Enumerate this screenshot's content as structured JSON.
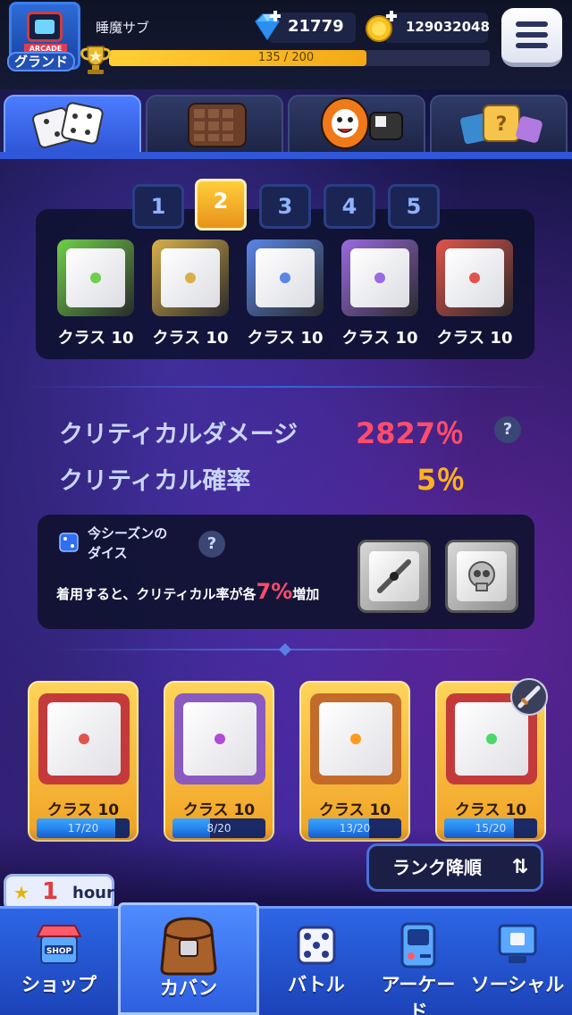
{
  "header": {
    "username": "睡魔サブ",
    "rank": "グランド",
    "avatar_text": "ARCADE",
    "xp_text": "135 / 200",
    "xp_fraction": 0.675,
    "gems": "21779",
    "coins": "129032048"
  },
  "deck_pages": [
    "1",
    "2",
    "3",
    "4",
    "5"
  ],
  "active_page": "2",
  "deck": [
    {
      "label": "クラス 10",
      "color": "#6fcf4a"
    },
    {
      "label": "クラス 10",
      "color": "#d8b04a"
    },
    {
      "label": "クラス 10",
      "color": "#5a86e8"
    },
    {
      "label": "クラス 10",
      "color": "#9a6ae0"
    },
    {
      "label": "クラス 10",
      "color": "#e0544a"
    }
  ],
  "stats": {
    "crit_damage_label": "クリティカルダメージ",
    "crit_damage_value": "2827％",
    "crit_rate_label": "クリティカル確率",
    "crit_rate_value": "5％",
    "help": "?"
  },
  "season": {
    "title_line1": "今シーズンの",
    "title_line2": "ダイス",
    "desc_before": "着用すると、クリティカル率が各",
    "desc_pct": "7%",
    "desc_after": "増加",
    "help": "?"
  },
  "inventory": [
    {
      "label": "クラス 10",
      "progress": "17/20",
      "fraction": 0.85,
      "color": "#e0544a",
      "frame": "#c43a3a"
    },
    {
      "label": "クラス 10",
      "progress": "8/20",
      "fraction": 0.4,
      "color": "#b04ad8",
      "frame": "#8a5ac0"
    },
    {
      "label": "クラス 10",
      "progress": "13/20",
      "fraction": 0.65,
      "color": "#ff9a1f",
      "frame": "#c46a2a"
    },
    {
      "label": "クラス 10",
      "progress": "15/20",
      "fraction": 0.75,
      "color": "#4ad86a",
      "frame": "#c43a3a"
    }
  ],
  "sort_button": "ランク降順",
  "timer": {
    "value": "1",
    "unit": "hour"
  },
  "nav": [
    {
      "label": "ショップ",
      "icon": "shop-icon",
      "sub": "SHOP"
    },
    {
      "label": "カバン",
      "icon": "bag-icon"
    },
    {
      "label": "バトル",
      "icon": "battle-dice-icon"
    },
    {
      "label": "アーケード",
      "icon": "arcade-icon"
    },
    {
      "label": "ソーシャル",
      "icon": "social-icon"
    }
  ],
  "colors": {
    "accent": "#2e55d6",
    "crit_damage": "#ff4c6b",
    "crit_rate": "#ffb21f",
    "gold": "#f4a917"
  }
}
